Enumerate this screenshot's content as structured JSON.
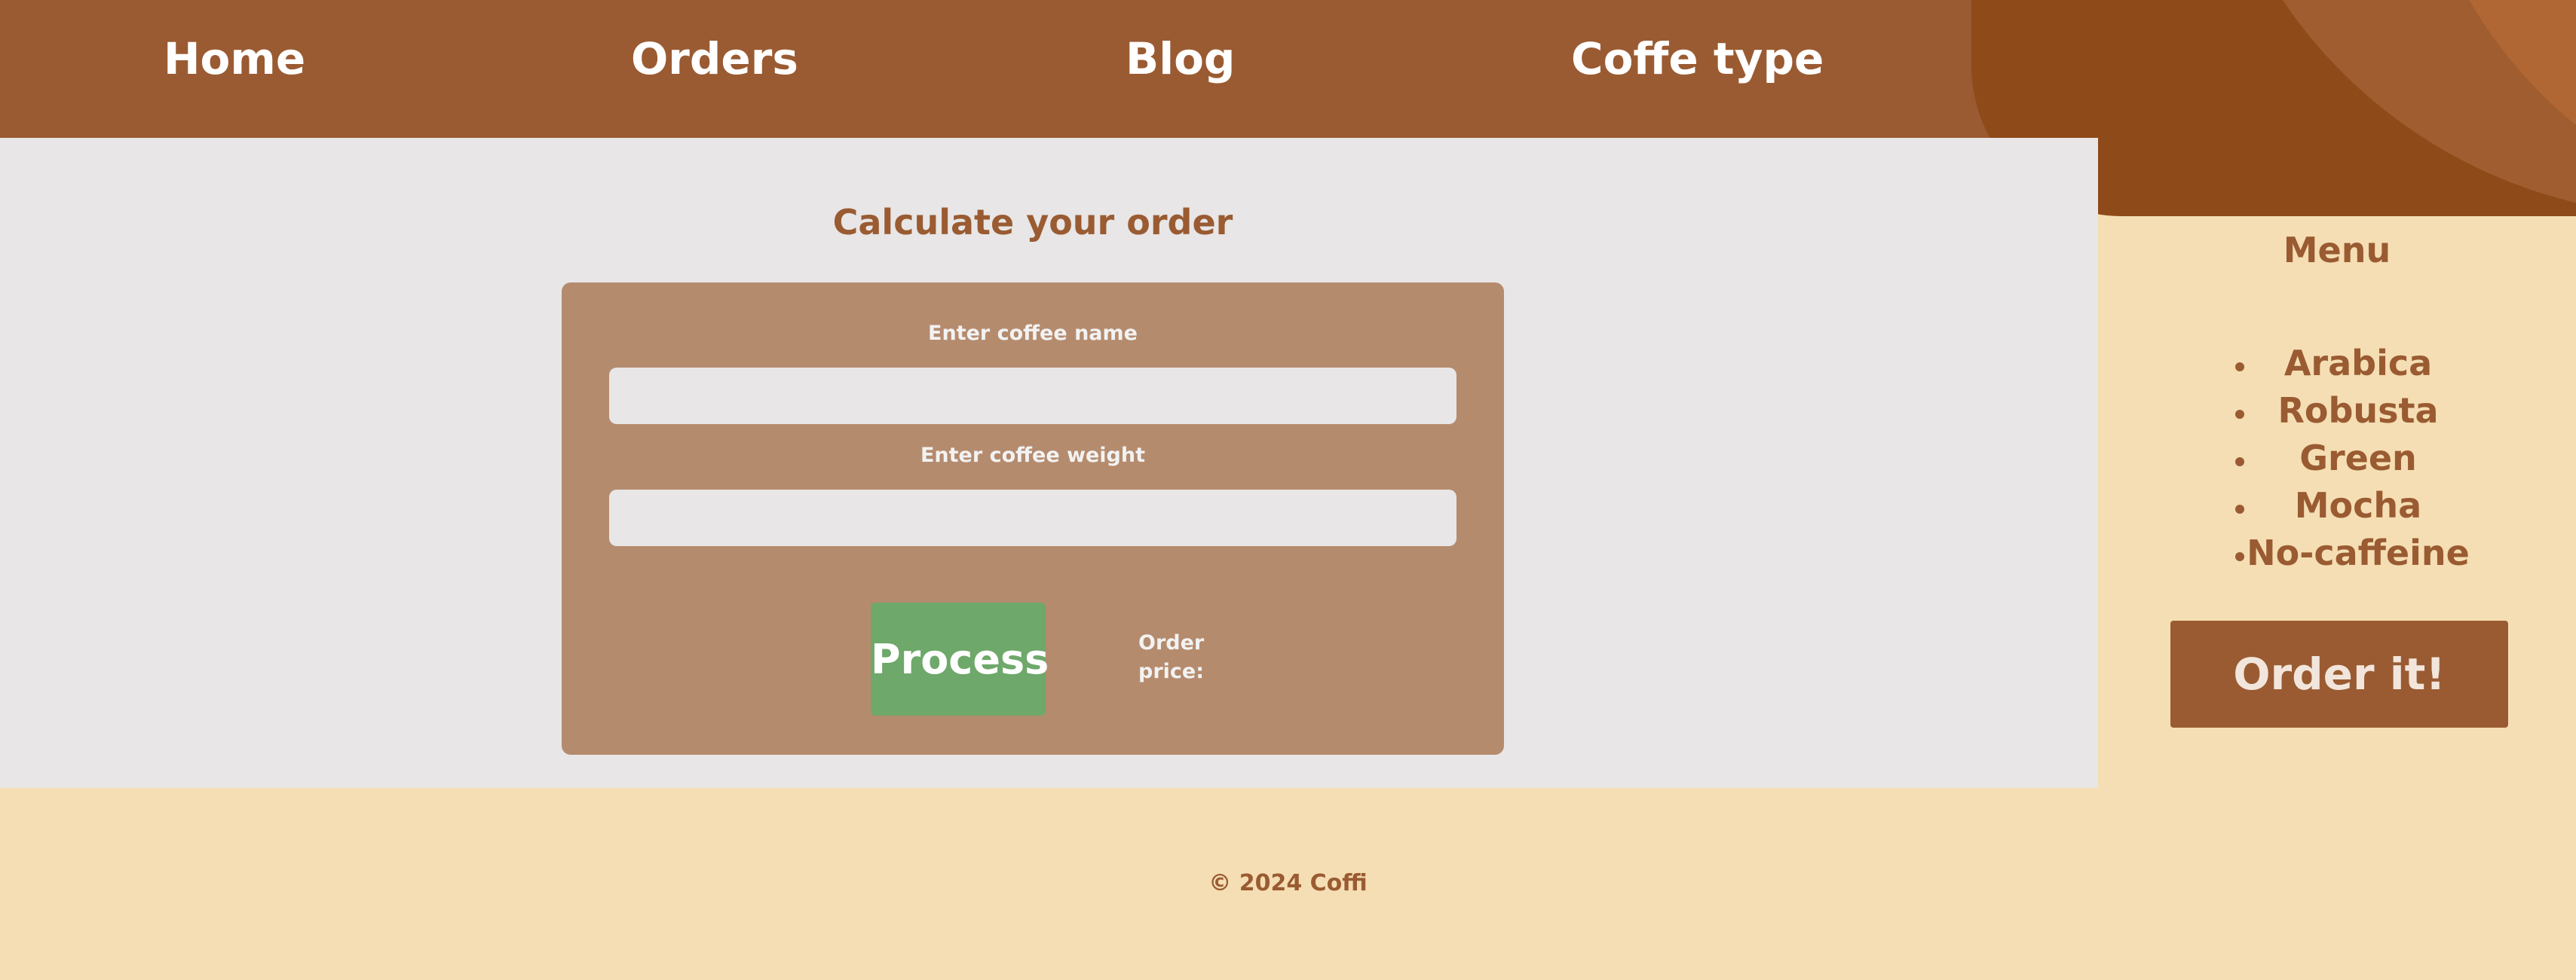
{
  "nav": {
    "items": [
      {
        "label": "Home"
      },
      {
        "label": "Orders"
      },
      {
        "label": "Blog"
      },
      {
        "label": "Coffe type"
      }
    ]
  },
  "calculator": {
    "title": "Calculate your order",
    "name_label": "Enter coffee name",
    "name_value": "",
    "weight_label": "Enter coffee weight",
    "weight_value": "",
    "process_label": "Process",
    "price_label": "Order price:",
    "price_value": ""
  },
  "menu": {
    "title": "Menu",
    "items": [
      {
        "label": "Arabica"
      },
      {
        "label": "Robusta"
      },
      {
        "label": "Green"
      },
      {
        "label": "Mocha"
      },
      {
        "label": "No-caffeine"
      }
    ],
    "order_label": "Order it!"
  },
  "footer": {
    "copyright": "© 2024 Coffi"
  },
  "colors": {
    "brand_brown": "#9a5b32",
    "card_tan": "#b58b6e",
    "process_green": "#6ea86a",
    "cream": "#f5deb3",
    "light_gray": "#e8e6e6"
  }
}
